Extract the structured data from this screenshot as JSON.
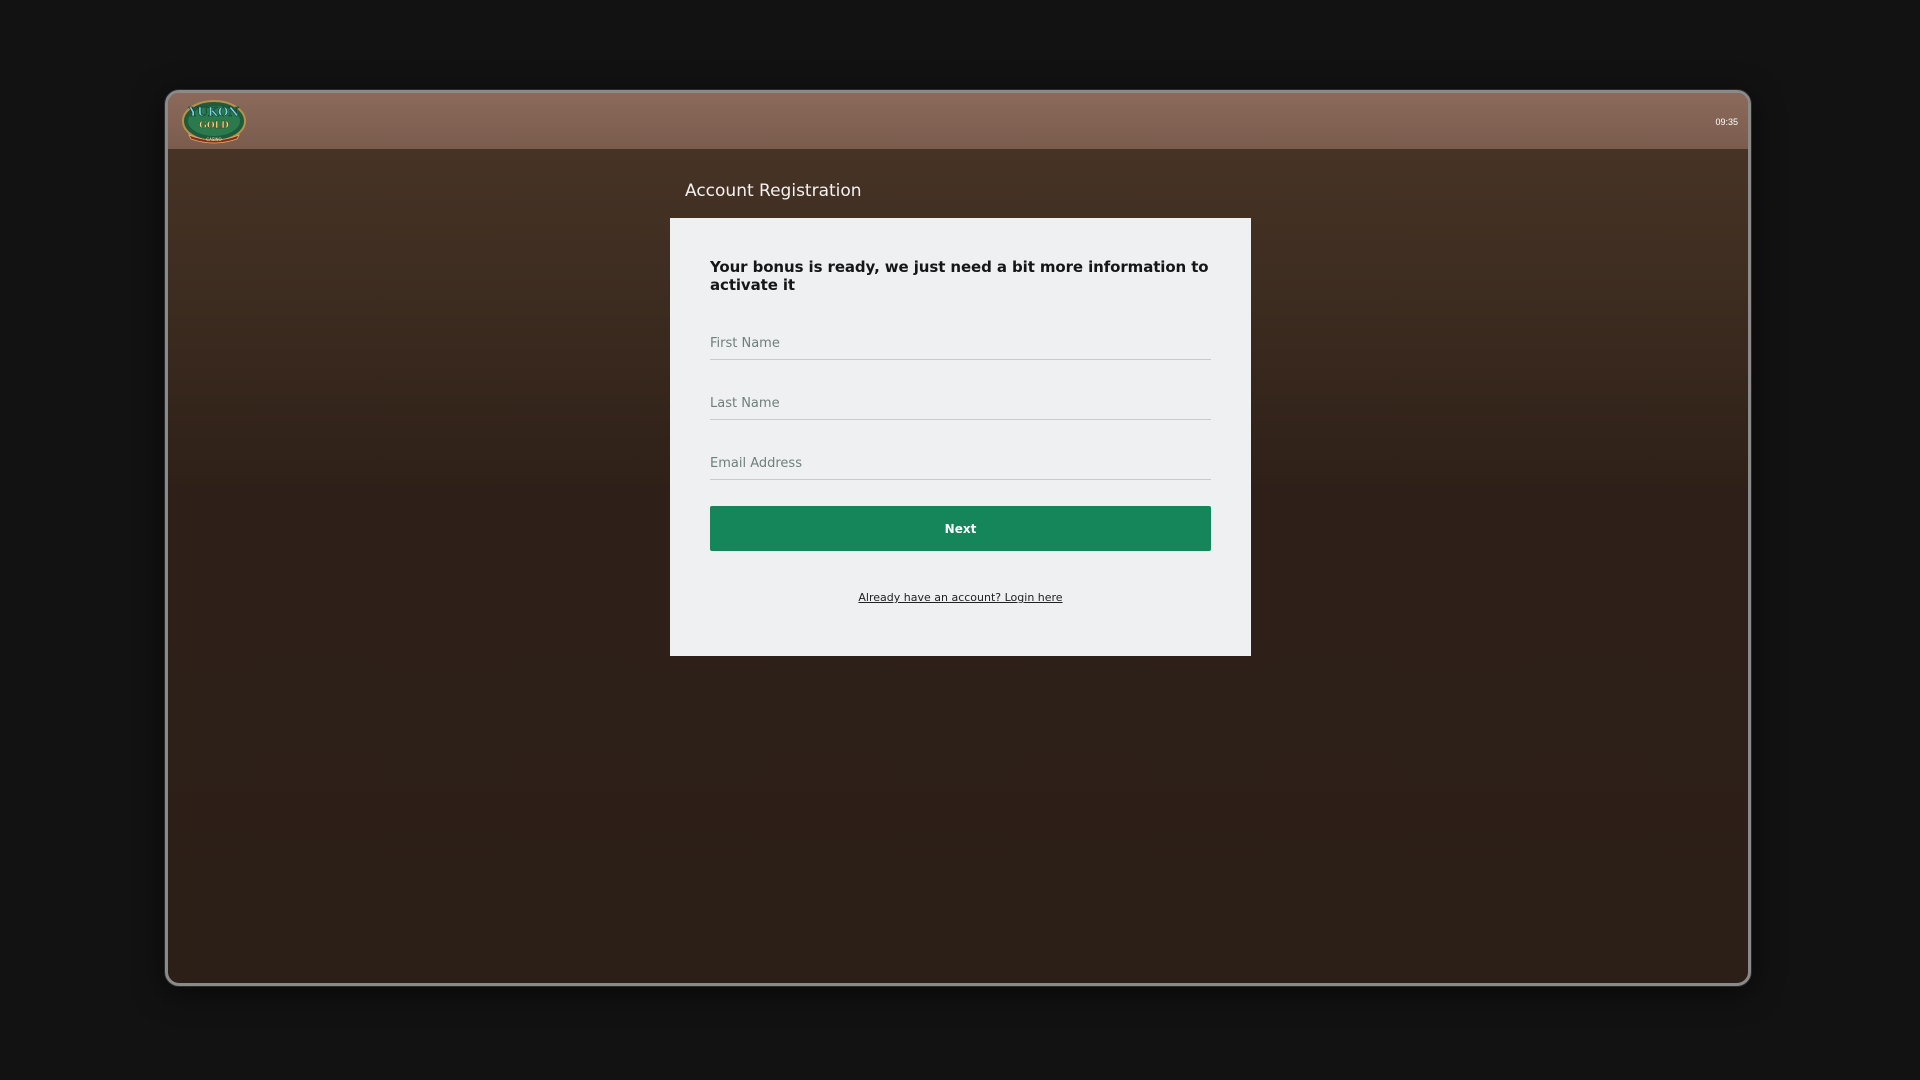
{
  "header": {
    "logo_name": "yukon-gold-casino-logo",
    "logo_text_top": "YUKON",
    "logo_text_mid": "GOLD",
    "logo_text_bottom": "CASINO",
    "time": "09:35"
  },
  "page": {
    "title": "Account Registration"
  },
  "form": {
    "headline": "Your bonus is ready, we just need a bit more information to activate it",
    "first_name_placeholder": "First Name",
    "last_name_placeholder": "Last Name",
    "email_placeholder": "Email Address",
    "first_name_value": "",
    "last_name_value": "",
    "email_value": "",
    "next_label": "Next",
    "login_link_label": "Already have an account? Login here"
  },
  "colors": {
    "page_background": "#121212",
    "topbar": "#84665a",
    "content_background": "#2e2018",
    "card": "#eef0f2",
    "primary_button": "#14865a"
  }
}
